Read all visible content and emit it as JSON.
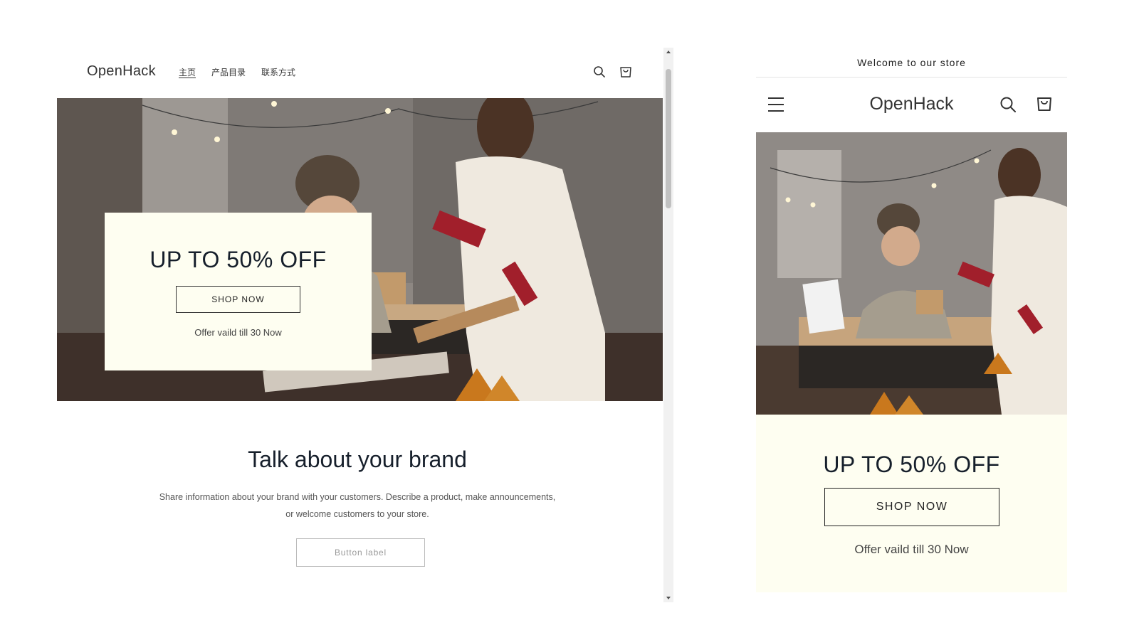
{
  "desktop": {
    "logo": "OpenHack",
    "nav": [
      {
        "label": "主页",
        "active": true
      },
      {
        "label": "产品目录",
        "active": false
      },
      {
        "label": "联系方式",
        "active": false
      }
    ],
    "icons": {
      "search": "search-icon",
      "cart": "cart-icon"
    },
    "promo": {
      "title": "UP TO 50% OFF",
      "button": "SHOP NOW",
      "offer": "Offer vaild till 30 Now"
    },
    "brand": {
      "title": "Talk about your brand",
      "text_line1": "Share information about your brand with your customers. Describe a product, make announcements,",
      "text_line2": "or welcome customers to your store.",
      "button": "Button label"
    }
  },
  "mobile": {
    "announcement": "Welcome to our store",
    "logo": "OpenHack",
    "icons": {
      "menu": "hamburger-menu-icon",
      "search": "search-icon",
      "cart": "cart-icon"
    },
    "promo": {
      "title": "UP TO 50% OFF",
      "button": "SHOP NOW",
      "offer": "Offer vaild till 30 Now"
    }
  },
  "colors": {
    "promo_background": "#fefef1",
    "heading_text": "#161f2b",
    "hero_wall": "#8a8480"
  }
}
